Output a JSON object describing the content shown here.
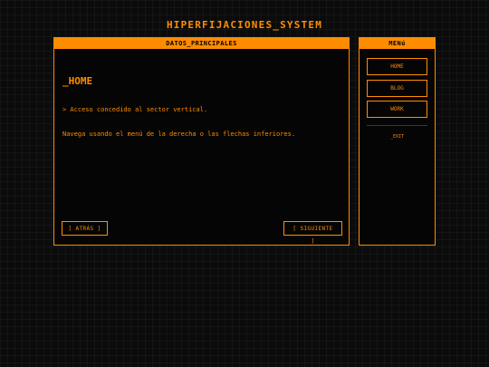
{
  "app": {
    "title": "HIPERFIJACIONES_SYSTEM"
  },
  "main_panel": {
    "header": "DATOS_PRINCIPALES",
    "section_title": "_HOME",
    "lines": [
      "> Acceso concedido al sector vertical.",
      "Navega usando el menú de la derecha o las flechas inferiores."
    ],
    "prev_label": "[ ATRÁS ]",
    "next_label": "[ SIGUIENTE ]"
  },
  "side_panel": {
    "header": "MENú",
    "items": [
      {
        "label": "HOME"
      },
      {
        "label": "BLOG"
      },
      {
        "label": "WORK"
      }
    ],
    "exit_label": "_EXIT"
  },
  "colors": {
    "accent": "#ff8c00",
    "background": "#0b0b0b"
  }
}
